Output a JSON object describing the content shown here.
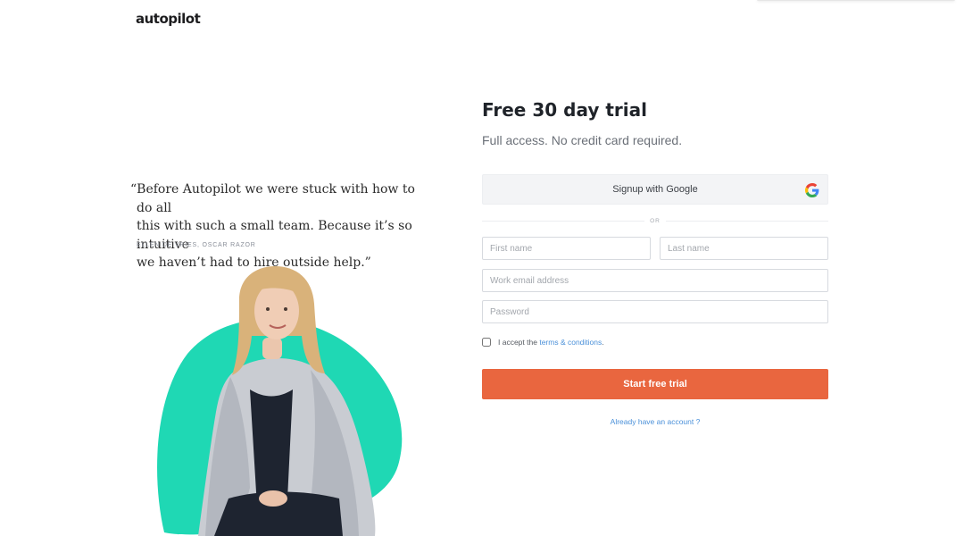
{
  "brand": {
    "logo_text": "autopilot"
  },
  "testimonial": {
    "quote_open": "“Before Autopilot we were stuck with how to do all",
    "quote_line2": "this with such a small team. Because it’s so intuitive",
    "quote_line3": "we haven’t had to hire outside help.”",
    "attribution": "ELLEN DE VRIES, OSCAR RAZOR"
  },
  "signup": {
    "title": "Free 30 day trial",
    "subtitle": "Full access. No credit card required.",
    "google_button_label": "Signup with Google",
    "or_label": "OR",
    "fields": {
      "first_name_placeholder": "First name",
      "last_name_placeholder": "Last name",
      "email_placeholder": "Work email address",
      "password_placeholder": "Password"
    },
    "terms": {
      "prefix": "I accept the",
      "link_text": "terms & conditions",
      "suffix": ".",
      "checked": false
    },
    "submit_label": "Start free trial",
    "login_link": "Already have an account ?"
  },
  "colors": {
    "accent": "#e9663f",
    "link": "#4a90d9",
    "blob": "#1fd8b4"
  }
}
